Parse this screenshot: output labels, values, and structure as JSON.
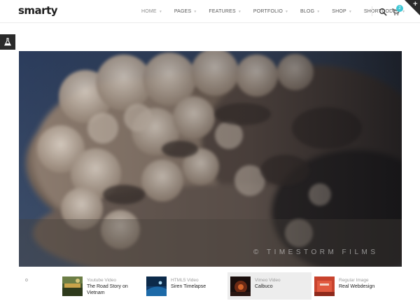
{
  "brand": {
    "logo": "smarty"
  },
  "nav": {
    "items": [
      {
        "label": "HOME",
        "active": true
      },
      {
        "label": "PAGES"
      },
      {
        "label": "FEATURES"
      },
      {
        "label": "PORTFOLIO"
      },
      {
        "label": "BLOG"
      },
      {
        "label": "SHOP"
      },
      {
        "label": "SHORTCODES"
      }
    ],
    "cart_count": "2"
  },
  "hero": {
    "watermark": "© TIMESTORM FILMS"
  },
  "slider": {
    "marker": "o",
    "items": [
      {
        "type": "Youtube Video",
        "title": "The Road Story on Vietnam"
      },
      {
        "type": "HTML5 Video",
        "title": "Siren Timelapse"
      },
      {
        "type": "Vimeo Video",
        "title": "Calbuco",
        "active": true
      },
      {
        "type": "Regular Image",
        "title": "Real Webdesign"
      }
    ]
  },
  "colors": {
    "accent": "#3fc8d6",
    "dark": "#2a2a2a",
    "active_thumb_bg": "#ededed"
  },
  "icons": [
    "flask-icon",
    "search-icon",
    "cart-icon",
    "plus-icon"
  ]
}
